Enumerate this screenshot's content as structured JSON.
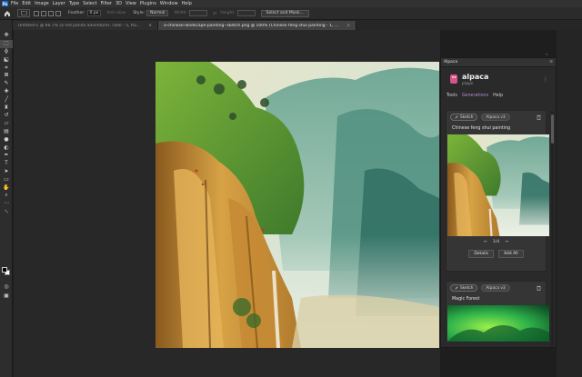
{
  "menubar": {
    "items": [
      "File",
      "Edit",
      "Image",
      "Layer",
      "Type",
      "Select",
      "Filter",
      "3D",
      "View",
      "Plugins",
      "Window",
      "Help"
    ]
  },
  "optionsbar": {
    "feather_label": "Feather:",
    "feather_value": "0 px",
    "antialias_label": "Anti-alias",
    "style_label": "Style:",
    "style_value": "Normal",
    "width_label": "Width:",
    "height_label": "Height:",
    "select_mask_label": "Select and Mask..."
  },
  "tabs": [
    {
      "label": "Untitled-1 @ 66.7% (a red panda adventurer, rado - 5, RGB/8#) [scaled] *",
      "active": false
    },
    {
      "label": "a-chinese-landscape-painting--sketch.png @ 100% (Chinese feng shui painting - 1, RGB/8#) *",
      "active": true
    }
  ],
  "panel": {
    "tab_title": "Alpaca",
    "brand": "alpaca",
    "brand_sub": "plugin",
    "nav": [
      "Tools",
      "Generations",
      "Help"
    ],
    "cards": [
      {
        "chip_type": "Sketch",
        "chip_model": "Alpaca v3",
        "prompt": "Chinese feng shui painting",
        "pager": "1/4",
        "details_label": "Details",
        "add_all_label": "Add All"
      },
      {
        "chip_type": "Sketch",
        "chip_model": "Alpaca v3",
        "prompt": "Magic Forest"
      }
    ]
  },
  "colors": {
    "accent": "#b38bd1",
    "brand_pink": "#d5548a",
    "ps_blue": "#1f6fd1"
  }
}
